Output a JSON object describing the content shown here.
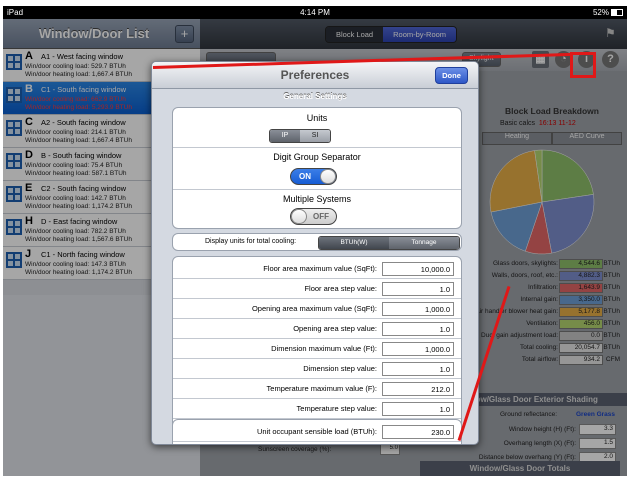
{
  "status_bar": {
    "device": "iPad",
    "time": "4:14 PM",
    "battery": "52%"
  },
  "left_panel": {
    "title": "Window/Door List",
    "add_label": "+",
    "items": [
      {
        "letter": "A",
        "name": "A1 - West facing window",
        "cooling": "Win/door cooling load: 529.7 BTUh",
        "heating": "Win/door heating load: 1,667.4 BTUh",
        "selected": false
      },
      {
        "letter": "B",
        "name": "C1 - South facing window",
        "cooling": "Win/door cooling load: 662.9 BTUh",
        "heating": "Win/door heating load: 5,293.9 BTUh",
        "selected": true
      },
      {
        "letter": "C",
        "name": "A2 - South facing window",
        "cooling": "Win/door cooling load: 214.1 BTUh",
        "heating": "Win/door heating load: 1,667.4 BTUh",
        "selected": false
      },
      {
        "letter": "D",
        "name": "B - South facing window",
        "cooling": "Win/door cooling load: 75.4 BTUh",
        "heating": "Win/door heating load: 587.1 BTUh",
        "selected": false
      },
      {
        "letter": "E",
        "name": "C2 - South facing window",
        "cooling": "Win/door cooling load: 142.7 BTUh",
        "heating": "Win/door heating load: 1,174.2 BTUh",
        "selected": false
      },
      {
        "letter": "H",
        "name": "D - East facing window",
        "cooling": "Win/door cooling load: 782.2 BTUh",
        "heating": "Win/door heating load: 1,567.6 BTUh",
        "selected": false
      },
      {
        "letter": "J",
        "name": "C1 - North facing window",
        "cooling": "Win/door cooling load: 147.3 BTUh",
        "heating": "Win/door heating load: 1,174.2 BTUh",
        "selected": false
      }
    ]
  },
  "header": {
    "segments": [
      "Block Load",
      "Room-by-Room"
    ],
    "selected_segment": "Room-by-Room"
  },
  "toolbar": {
    "skylight_label": "Skylight"
  },
  "right_panel": {
    "block_load_title": "Block Load Breakdown",
    "basic_calcs_label": "Basic calcs",
    "basic_calcs_time": "16:13 11-12",
    "tabs": [
      "Heating",
      "AED Curve"
    ],
    "breakdown": [
      {
        "label": "Glass doors, skylights:",
        "value": "4,544.6",
        "unit": "BTUh",
        "color": "#8fc06b"
      },
      {
        "label": "Walls, doors, roof, etc.:",
        "value": "4,882.3",
        "unit": "BTUh",
        "color": "#7f8fd0"
      },
      {
        "label": "Infiltration:",
        "value": "1,643.9",
        "unit": "BTUh",
        "color": "#e36868"
      },
      {
        "label": "Internal gain:",
        "value": "3,350.0",
        "unit": "BTUh",
        "color": "#6fa0d8"
      },
      {
        "label": "Air handler blower heat gain:",
        "value": "5,177.8",
        "unit": "BTUh",
        "color": "#e8b048"
      },
      {
        "label": "Ventilation:",
        "value": "456.0",
        "unit": "BTUh",
        "color": "#b6d870"
      },
      {
        "label": "Duct gain adjustment load:",
        "value": "0.0",
        "unit": "BTUh",
        "color": "#c8c8c8"
      },
      {
        "label": "Total cooling:",
        "value": "20,054.7",
        "unit": "BTUh",
        "color": "#e6e6e6"
      },
      {
        "label": "Total airflow:",
        "value": "934.2",
        "unit": "CFM",
        "color": "#e6e6e6"
      }
    ],
    "shading_title": "Window/Glass Door Exterior Shading",
    "ground_reflectance_label": "Ground reflectance:",
    "ground_reflectance_value": "Green Grass",
    "shading_rows": [
      {
        "label": "Window height (H) (Ft):",
        "value": "3.3"
      },
      {
        "label": "Overhang length (X) (Ft):",
        "value": "1.5"
      },
      {
        "label": "Distance below overhang (Y) (Ft):",
        "value": "2.0"
      }
    ],
    "sunscreen_label": "Sunscreen coverage (%):",
    "sunscreen_value": "5.0",
    "totals_title": "Window/Glass Door Totals"
  },
  "preferences": {
    "title": "Preferences",
    "done_label": "Done",
    "section_title": "General Settings",
    "units_label": "Units",
    "units_options": [
      "IP",
      "SI"
    ],
    "units_selected": "IP",
    "digit_group_label": "Digit Group Separator",
    "digit_group_state": "ON",
    "multiple_systems_label": "Multiple Systems",
    "multiple_systems_state": "OFF",
    "display_units_label": "Display units for total cooling:",
    "display_units_options": [
      "BTUh(W)",
      "Tonnage"
    ],
    "display_units_selected": "BTUh(W)",
    "fields": [
      {
        "label": "Floor area maximum value (SqFt):",
        "value": "10,000.0"
      },
      {
        "label": "Floor area step value:",
        "value": "1.0"
      },
      {
        "label": "Opening area maximum value (SqFt):",
        "value": "1,000.0"
      },
      {
        "label": "Opening area step value:",
        "value": "1.0"
      },
      {
        "label": "Dimension maximum value (Ft):",
        "value": "1,000.0"
      },
      {
        "label": "Dimension step value:",
        "value": "1.0"
      },
      {
        "label": "Temperature maximum value (F):",
        "value": "212.0"
      },
      {
        "label": "Temperature step value:",
        "value": "1.0"
      }
    ],
    "occupant_label": "Unit occupant sensible load (BTUh):",
    "occupant_value": "230.0"
  },
  "pie_slices": [
    {
      "value": 4544.6,
      "color": "#8fc06b"
    },
    {
      "value": 4882.3,
      "color": "#7f8fd0"
    },
    {
      "value": 1643.9,
      "color": "#e36868"
    },
    {
      "value": 3350.0,
      "color": "#6fa0d8"
    },
    {
      "value": 5177.8,
      "color": "#e8b048"
    },
    {
      "value": 456.0,
      "color": "#b6d870"
    }
  ],
  "colors": {
    "accent": "#165cd4",
    "highlight": "#e01818"
  }
}
